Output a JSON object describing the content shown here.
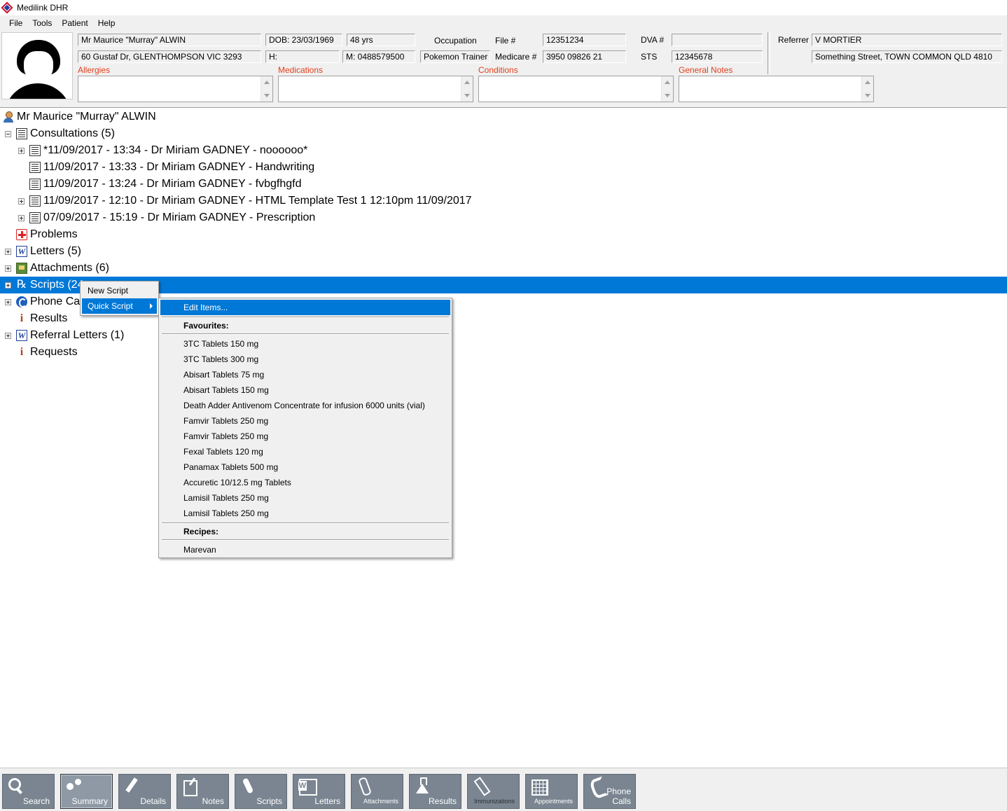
{
  "window": {
    "title": "Medilink DHR"
  },
  "menubar": {
    "items": [
      "File",
      "Tools",
      "Patient",
      "Help"
    ]
  },
  "patient": {
    "name": "Mr Maurice \"Murray\" ALWIN",
    "address": "60 Gustaf Dr, GLENTHOMPSON VIC 3293",
    "dob": "DOB: 23/03/1969",
    "age": "48 yrs",
    "home_phone": "H:",
    "mobile": "M: 0488579500",
    "occupation_label": "Occupation",
    "occupation": "Pokemon Trainer",
    "file_label": "File #",
    "file": "12351234",
    "medicare_label": "Medicare #",
    "medicare": "3950 09826 21",
    "dva_label": "DVA #",
    "dva": "",
    "sts_label": "STS",
    "sts": "12345678",
    "referrer_label": "Referrer",
    "referrer": "V MORTIER",
    "referrer_address": "Something Street, TOWN COMMON QLD 4810"
  },
  "notes": {
    "allergies_label": "Allergies",
    "medications_label": "Medications",
    "conditions_label": "Conditions",
    "general_label": "General Notes"
  },
  "tree": {
    "root": "Mr Maurice \"Murray\" ALWIN",
    "consultations": "Consultations (5)",
    "consults": [
      "*11/09/2017 - 13:34 - Dr Miriam GADNEY - noooooo*",
      "11/09/2017 - 13:33 - Dr Miriam GADNEY - Handwriting",
      "11/09/2017 - 13:24 - Dr Miriam GADNEY - fvbgfhgfd",
      "11/09/2017 - 12:10 - Dr Miriam GADNEY - HTML Template Test 1 12:10pm 11/09/2017",
      "07/09/2017 - 15:19 - Dr Miriam GADNEY - Prescription"
    ],
    "problems": "Problems",
    "letters": "Letters (5)",
    "attachments": "Attachments (6)",
    "scripts": "Scripts (24",
    "phone_calls": "Phone Cal",
    "results": "Results",
    "referral_letters": "Referral Letters (1)",
    "requests": "Requests"
  },
  "context_menu": {
    "new_script": "New Script",
    "quick_script": "Quick Script"
  },
  "submenu": {
    "edit_items": "Edit Items...",
    "favourites_heading": "Favourites:",
    "favourites": [
      "3TC Tablets  150 mg",
      "3TC Tablets  300 mg",
      "Abisart Tablets  75 mg",
      "Abisart Tablets  150 mg",
      "Death Adder Antivenom Concentrate for infusion 6000 units (vial)",
      "Famvir Tablets  250 mg",
      "Famvir Tablets  250 mg",
      "Fexal Tablets  120 mg",
      "Panamax Tablets  500 mg",
      "Accuretic 10/12.5 mg Tablets",
      "Lamisil Tablets  250 mg",
      "Lamisil Tablets  250 mg"
    ],
    "recipes_heading": "Recipes:",
    "recipes": [
      "Marevan"
    ]
  },
  "toolbar": {
    "search": "Search",
    "summary": "Summary",
    "details": "Details",
    "notes": "Notes",
    "scripts": "Scripts",
    "letters": "Letters",
    "attachments": "Attachments",
    "results": "Results",
    "immunizations": "Immunizations",
    "appointments": "Appointments",
    "phone_calls_1": "Phone",
    "phone_calls_2": "Calls"
  },
  "colors": {
    "selection": "#0078d7",
    "toolbar_button": "#7a8591",
    "note_label": "#e0401c"
  }
}
